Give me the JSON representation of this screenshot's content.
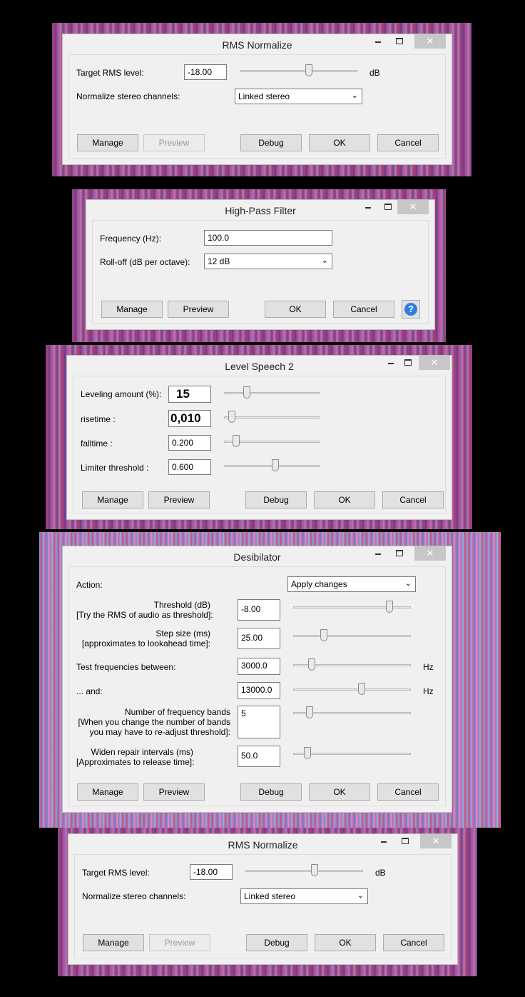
{
  "rms1": {
    "title": "RMS Normalize",
    "target_label": "Target RMS level:",
    "target_value": "-18.00",
    "target_unit": "dB",
    "target_slider": 0.59,
    "stereo_label": "Normalize stereo channels:",
    "stereo_value": "Linked stereo",
    "buttons": {
      "manage": "Manage",
      "preview": "Preview",
      "debug": "Debug",
      "ok": "OK",
      "cancel": "Cancel"
    }
  },
  "highpass": {
    "title": "High-Pass Filter",
    "freq_label": "Frequency (Hz):",
    "freq_value": "100.0",
    "rolloff_label": "Roll-off (dB per octave):",
    "rolloff_value": "12 dB",
    "buttons": {
      "manage": "Manage",
      "preview": "Preview",
      "ok": "OK",
      "cancel": "Cancel"
    },
    "help_glyph": "?"
  },
  "level": {
    "title": "Level Speech 2",
    "rows": [
      {
        "label": "Leveling amount (%):",
        "value": "15",
        "slider": 0.24
      },
      {
        "label": "risetime :",
        "value": "0,010",
        "slider": 0.08
      },
      {
        "label": "falltime :",
        "value": "0.200",
        "slider": 0.13
      },
      {
        "label": "Limiter threshold :",
        "value": "0.600",
        "slider": 0.54
      }
    ],
    "buttons": {
      "manage": "Manage",
      "preview": "Preview",
      "debug": "Debug",
      "ok": "OK",
      "cancel": "Cancel"
    }
  },
  "desib": {
    "title": "Desibilator",
    "action_label": "Action:",
    "action_value": "Apply changes",
    "threshold_label_1": "Threshold (dB)",
    "threshold_label_2": "[Try the RMS of audio as threshold]:",
    "threshold_value": "-8.00",
    "threshold_slider": 0.82,
    "step_label_1": "Step size (ms)",
    "step_label_2": "[approximates to lookahead time]:",
    "step_value": "25.00",
    "step_slider": 0.26,
    "testfreq_label": "Test frequencies between:",
    "testfreq_value": "3000.0",
    "testfreq_slider": 0.16,
    "testfreq_unit": "Hz",
    "and_label": "... and:",
    "and_value": "13000.0",
    "and_slider": 0.58,
    "and_unit": "Hz",
    "bands_label_1": "Number of frequency bands",
    "bands_label_2": "[When you change the number of bands",
    "bands_label_3": "you may have to re-adjust threshold]:",
    "bands_value": "5",
    "bands_slider": 0.14,
    "widen_label_1": "Widen repair intervals (ms)",
    "widen_label_2": "[Approximates to release time]:",
    "widen_value": "50.0",
    "widen_slider": 0.12,
    "buttons": {
      "manage": "Manage",
      "preview": "Preview",
      "debug": "Debug",
      "ok": "OK",
      "cancel": "Cancel"
    }
  },
  "rms2": {
    "title": "RMS Normalize",
    "target_label": "Target RMS level:",
    "target_value": "-18.00",
    "target_unit": "dB",
    "target_slider": 0.59,
    "stereo_label": "Normalize stereo channels:",
    "stereo_value": "Linked stereo",
    "buttons": {
      "manage": "Manage",
      "preview": "Preview",
      "debug": "Debug",
      "ok": "OK",
      "cancel": "Cancel"
    }
  },
  "window_controls": {
    "close_glyph": "✕"
  }
}
